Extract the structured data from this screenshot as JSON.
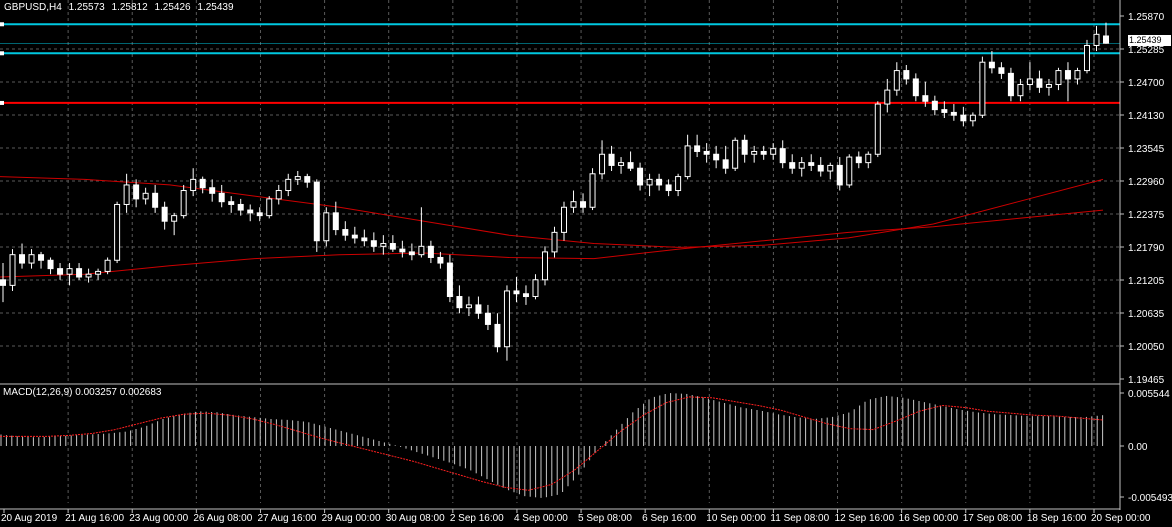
{
  "header": {
    "symbol": "GBPUSD,H4",
    "open": "1.25573",
    "high": "1.25812",
    "low": "1.25426",
    "close": "1.25439"
  },
  "current_price_label": "1.25439",
  "price_axis_labels": [
    "1.25870",
    "1.25285",
    "1.24700",
    "1.24130",
    "1.23545",
    "1.22960",
    "1.22375",
    "1.21790",
    "1.21205",
    "1.20635",
    "1.20050",
    "1.19465"
  ],
  "time_axis_labels": [
    "20 Aug 2019",
    "21 Aug 16:00",
    "23 Aug 00:00",
    "26 Aug 08:00",
    "27 Aug 16:00",
    "29 Aug 00:00",
    "30 Aug 08:00",
    "2 Sep 16:00",
    "4 Sep 00:00",
    "5 Sep 08:00",
    "6 Sep 16:00",
    "10 Sep 00:00",
    "11 Sep 08:00",
    "12 Sep 16:00",
    "16 Sep 00:00",
    "17 Sep 08:00",
    "18 Sep 16:00",
    "20 Sep 00:00"
  ],
  "indicator": {
    "label": "MACD(12,26,9) 0.003257 0.002683",
    "axis_labels": [
      "0.005544",
      "0.00",
      "-0.005493"
    ]
  },
  "horizontal_lines": [
    {
      "price": 1.2578,
      "color": "#00c8e0"
    },
    {
      "price": 1.2526,
      "color": "#00c8e0"
    },
    {
      "price": 1.2437,
      "color": "#ff0000"
    }
  ],
  "colors": {
    "background": "#000000",
    "grid": "#5a5a5a",
    "bull_candle": "#000000",
    "bear_candle": "#ffffff",
    "ma_line": "#cc0000",
    "macd_hist": "#c8c8c8",
    "macd_signal": "#ff2020"
  },
  "chart_data": {
    "type": "candlestick",
    "symbol": "GBPUSD,H4",
    "ylim": [
      1.1935,
      1.26
    ],
    "candles": [
      [
        1.212,
        1.215,
        1.208,
        1.211
      ],
      [
        1.211,
        1.2175,
        1.21,
        1.2165
      ],
      [
        1.2165,
        1.2185,
        1.214,
        1.215
      ],
      [
        1.215,
        1.2175,
        1.214,
        1.2165
      ],
      [
        1.2165,
        1.217,
        1.214,
        1.2155
      ],
      [
        1.2155,
        1.216,
        1.213,
        1.214
      ],
      [
        1.214,
        1.215,
        1.212,
        1.213
      ],
      [
        1.213,
        1.215,
        1.211,
        1.214
      ],
      [
        1.214,
        1.215,
        1.212,
        1.2125
      ],
      [
        1.2125,
        1.214,
        1.2115,
        1.213
      ],
      [
        1.213,
        1.214,
        1.212,
        1.2135
      ],
      [
        1.2135,
        1.216,
        1.213,
        1.2155
      ],
      [
        1.2155,
        1.226,
        1.215,
        1.2255
      ],
      [
        1.2255,
        1.231,
        1.224,
        1.229
      ],
      [
        1.229,
        1.23,
        1.225,
        1.2265
      ],
      [
        1.2265,
        1.2285,
        1.2255,
        1.2275
      ],
      [
        1.2275,
        1.229,
        1.224,
        1.225
      ],
      [
        1.225,
        1.226,
        1.221,
        1.2225
      ],
      [
        1.2225,
        1.224,
        1.22,
        1.2235
      ],
      [
        1.2235,
        1.229,
        1.223,
        1.228
      ],
      [
        1.228,
        1.232,
        1.227,
        1.23
      ],
      [
        1.23,
        1.2305,
        1.2275,
        1.2285
      ],
      [
        1.2285,
        1.23,
        1.226,
        1.2275
      ],
      [
        1.2275,
        1.229,
        1.225,
        1.226
      ],
      [
        1.226,
        1.227,
        1.224,
        1.2255
      ],
      [
        1.2255,
        1.2265,
        1.2235,
        1.2245
      ],
      [
        1.2245,
        1.2255,
        1.2225,
        1.224
      ],
      [
        1.224,
        1.225,
        1.2225,
        1.2235
      ],
      [
        1.2235,
        1.227,
        1.223,
        1.2265
      ],
      [
        1.2265,
        1.229,
        1.2255,
        1.228
      ],
      [
        1.228,
        1.231,
        1.227,
        1.23
      ],
      [
        1.23,
        1.2315,
        1.229,
        1.2305
      ],
      [
        1.2305,
        1.231,
        1.2285,
        1.2295
      ],
      [
        1.2295,
        1.23,
        1.217,
        1.219
      ],
      [
        1.219,
        1.225,
        1.218,
        1.224
      ],
      [
        1.224,
        1.226,
        1.22,
        1.221
      ],
      [
        1.221,
        1.2225,
        1.219,
        1.22
      ],
      [
        1.22,
        1.2215,
        1.2185,
        1.2195
      ],
      [
        1.2195,
        1.221,
        1.218,
        1.219
      ],
      [
        1.219,
        1.2205,
        1.217,
        1.218
      ],
      [
        1.218,
        1.22,
        1.2165,
        1.2185
      ],
      [
        1.2185,
        1.22,
        1.217,
        1.2175
      ],
      [
        1.2175,
        1.219,
        1.216,
        1.217
      ],
      [
        1.217,
        1.2185,
        1.2155,
        1.2165
      ],
      [
        1.2165,
        1.225,
        1.216,
        1.218
      ],
      [
        1.218,
        1.219,
        1.215,
        1.216
      ],
      [
        1.216,
        1.217,
        1.214,
        1.215
      ],
      [
        1.215,
        1.2165,
        1.208,
        1.209
      ],
      [
        1.209,
        1.211,
        1.206,
        1.207
      ],
      [
        1.207,
        1.209,
        1.2055,
        1.2075
      ],
      [
        1.2075,
        1.209,
        1.205,
        1.206
      ],
      [
        1.206,
        1.2075,
        1.203,
        1.204
      ],
      [
        1.204,
        1.206,
        1.199,
        1.2
      ],
      [
        1.2,
        1.211,
        1.1975,
        1.21
      ],
      [
        1.21,
        1.2125,
        1.208,
        1.2095
      ],
      [
        1.2095,
        1.211,
        1.2075,
        1.209
      ],
      [
        1.209,
        1.213,
        1.2085,
        1.212
      ],
      [
        1.212,
        1.218,
        1.211,
        1.217
      ],
      [
        1.217,
        1.2215,
        1.216,
        1.2205
      ],
      [
        1.2205,
        1.226,
        1.219,
        1.225
      ],
      [
        1.225,
        1.228,
        1.224,
        1.226
      ],
      [
        1.226,
        1.2275,
        1.224,
        1.225
      ],
      [
        1.225,
        1.232,
        1.2245,
        1.231
      ],
      [
        1.231,
        1.237,
        1.23,
        1.2345
      ],
      [
        1.2345,
        1.236,
        1.2315,
        1.2325
      ],
      [
        1.2325,
        1.234,
        1.231,
        1.233
      ],
      [
        1.233,
        1.235,
        1.2315,
        1.232
      ],
      [
        1.232,
        1.233,
        1.228,
        1.229
      ],
      [
        1.229,
        1.231,
        1.227,
        1.23
      ],
      [
        1.23,
        1.231,
        1.228,
        1.229
      ],
      [
        1.229,
        1.23,
        1.227,
        1.228
      ],
      [
        1.228,
        1.231,
        1.227,
        1.2305
      ],
      [
        1.2305,
        1.238,
        1.23,
        1.236
      ],
      [
        1.236,
        1.238,
        1.234,
        1.235
      ],
      [
        1.235,
        1.2365,
        1.233,
        1.2345
      ],
      [
        1.2345,
        1.236,
        1.232,
        1.2335
      ],
      [
        1.2335,
        1.236,
        1.231,
        1.232
      ],
      [
        1.232,
        1.2375,
        1.2315,
        1.237
      ],
      [
        1.237,
        1.238,
        1.233,
        1.2345
      ],
      [
        1.2345,
        1.236,
        1.233,
        1.235
      ],
      [
        1.235,
        1.236,
        1.2335,
        1.2345
      ],
      [
        1.2345,
        1.2365,
        1.2335,
        1.2355
      ],
      [
        1.2355,
        1.237,
        1.232,
        1.233
      ],
      [
        1.233,
        1.2345,
        1.231,
        1.232
      ],
      [
        1.232,
        1.234,
        1.2305,
        1.233
      ],
      [
        1.233,
        1.2345,
        1.2315,
        1.2325
      ],
      [
        1.2325,
        1.234,
        1.2305,
        1.2315
      ],
      [
        1.2315,
        1.233,
        1.23,
        1.2325
      ],
      [
        1.2325,
        1.234,
        1.228,
        1.229
      ],
      [
        1.229,
        1.2345,
        1.2285,
        1.234
      ],
      [
        1.234,
        1.235,
        1.232,
        1.233
      ],
      [
        1.233,
        1.235,
        1.232,
        1.2345
      ],
      [
        1.2345,
        1.244,
        1.234,
        1.2435
      ],
      [
        1.2435,
        1.248,
        1.242,
        1.246
      ],
      [
        1.246,
        1.251,
        1.245,
        1.2495
      ],
      [
        1.2495,
        1.2505,
        1.247,
        1.248
      ],
      [
        1.248,
        1.249,
        1.244,
        1.245
      ],
      [
        1.245,
        1.2475,
        1.243,
        1.244
      ],
      [
        1.244,
        1.245,
        1.2415,
        1.2425
      ],
      [
        1.2425,
        1.244,
        1.241,
        1.242
      ],
      [
        1.242,
        1.2435,
        1.2405,
        1.2415
      ],
      [
        1.2415,
        1.243,
        1.2395,
        1.2405
      ],
      [
        1.2405,
        1.242,
        1.2395,
        1.2415
      ],
      [
        1.2415,
        1.252,
        1.241,
        1.251
      ],
      [
        1.251,
        1.253,
        1.249,
        1.25
      ],
      [
        1.25,
        1.251,
        1.248,
        1.249
      ],
      [
        1.249,
        1.25,
        1.244,
        1.245
      ],
      [
        1.245,
        1.248,
        1.244,
        1.247
      ],
      [
        1.247,
        1.251,
        1.246,
        1.248
      ],
      [
        1.248,
        1.2495,
        1.2455,
        1.2465
      ],
      [
        1.2465,
        1.248,
        1.245,
        1.247
      ],
      [
        1.247,
        1.25,
        1.246,
        1.2495
      ],
      [
        1.2495,
        1.251,
        1.244,
        1.248
      ],
      [
        1.248,
        1.25,
        1.247,
        1.2495
      ],
      [
        1.2495,
        1.255,
        1.249,
        1.254
      ],
      [
        1.254,
        1.2575,
        1.253,
        1.256
      ],
      [
        1.2557,
        1.2581,
        1.2543,
        1.2544
      ]
    ],
    "moving_averages": [
      {
        "points": [
          1.2305,
          1.23,
          1.229,
          1.227,
          1.225,
          1.2225,
          1.22,
          1.2185,
          1.2178,
          1.2182,
          1.2195,
          1.222,
          1.226,
          1.23
        ]
      },
      {
        "points": [
          1.2125,
          1.213,
          1.2145,
          1.2158,
          1.2165,
          1.2168,
          1.216,
          1.2158,
          1.2175,
          1.219,
          1.2205,
          1.2215,
          1.223,
          1.2245
        ]
      }
    ],
    "indicator_series": {
      "name": "MACD(12,26,9)",
      "macd": [
        0.0012,
        0.001,
        0.0009,
        0.001,
        0.0011,
        0.0012,
        0.0013,
        0.0015,
        0.002,
        0.0028,
        0.0033,
        0.0036,
        0.0035,
        0.0032,
        0.003,
        0.0028,
        0.0027,
        0.0025,
        0.002,
        0.0015,
        0.001,
        0.0005,
        0.0,
        -0.0006,
        -0.0012,
        -0.0018,
        -0.0025,
        -0.0035,
        -0.0045,
        -0.0052,
        -0.0054,
        -0.005,
        -0.003,
        -0.0005,
        0.0015,
        0.0035,
        0.005,
        0.0055,
        0.0054,
        0.005,
        0.0045,
        0.004,
        0.0037,
        0.0033,
        0.003,
        0.0028,
        0.003,
        0.0035,
        0.0048,
        0.0052,
        0.005,
        0.0046,
        0.0042,
        0.0038,
        0.0035,
        0.0033,
        0.0032,
        0.0031,
        0.0031,
        0.003,
        0.003,
        0.0032
      ],
      "signal": [
        0.001,
        0.001,
        0.001,
        0.0011,
        0.0013,
        0.0017,
        0.0023,
        0.0029,
        0.0033,
        0.0034,
        0.0032,
        0.0028,
        0.0022,
        0.0015,
        0.0008,
        0.0002,
        -0.0004,
        -0.001,
        -0.0016,
        -0.0023,
        -0.003,
        -0.0037,
        -0.0043,
        -0.0046,
        -0.004,
        -0.0025,
        -0.0005,
        0.0015,
        0.0032,
        0.0045,
        0.0051,
        0.005,
        0.0046,
        0.0042,
        0.0037,
        0.003,
        0.0023,
        0.0018,
        0.0017,
        0.0026,
        0.0036,
        0.0042,
        0.004,
        0.0036,
        0.0034,
        0.0032,
        0.0031,
        0.0029,
        0.0027
      ]
    }
  }
}
